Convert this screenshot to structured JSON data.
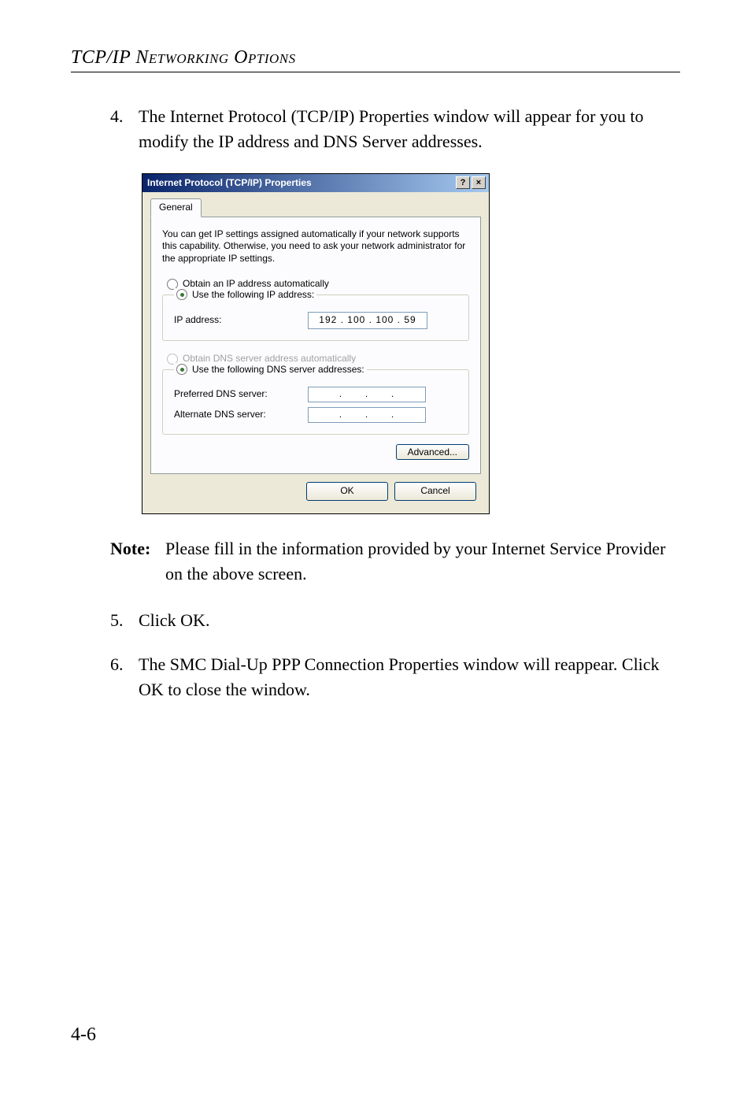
{
  "header": {
    "title": "TCP/IP Networking Options"
  },
  "items": {
    "four": {
      "num": "4.",
      "text": "The Internet Protocol (TCP/IP) Properties window will appear for you to modify the IP address and DNS Server addresses."
    },
    "five": {
      "num": "5.",
      "text": "Click OK."
    },
    "six": {
      "num": "6.",
      "text": "The SMC Dial-Up PPP Connection Properties window will reappear. Click OK to close the window."
    }
  },
  "note": {
    "label": "Note:",
    "text": "Please fill in the information provided by your Internet Service Provider on the above screen."
  },
  "dialog": {
    "title": "Internet Protocol (TCP/IP) Properties",
    "help_glyph": "?",
    "close_glyph": "×",
    "tab_general": "General",
    "description": "You can get IP settings assigned automatically if your network supports this capability. Otherwise, you need to ask your network administrator for the appropriate IP settings.",
    "radio_obtain_ip": "Obtain an IP address automatically",
    "radio_use_ip": "Use the following IP address:",
    "ip_label": "IP address:",
    "ip_value": "192 . 100 . 100 .  59",
    "radio_obtain_dns": "Obtain DNS server address automatically",
    "radio_use_dns": "Use the following DNS server addresses:",
    "preferred_dns_label": "Preferred DNS server:",
    "alternate_dns_label": "Alternate DNS server:",
    "dot": ".",
    "advanced_btn": "Advanced...",
    "ok_btn": "OK",
    "cancel_btn": "Cancel"
  },
  "page_number": "4-6"
}
